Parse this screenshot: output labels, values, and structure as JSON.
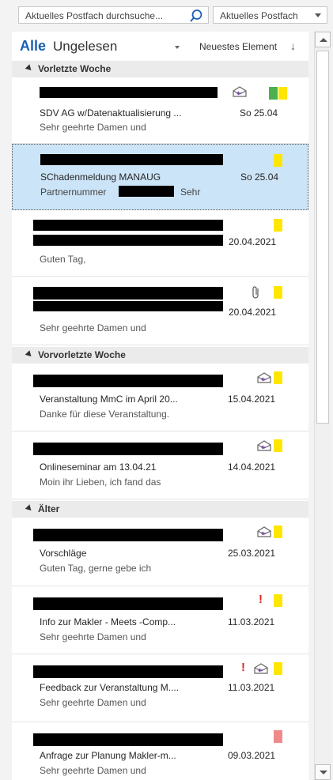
{
  "search": {
    "placeholder": "Aktuelles Postfach durchsuche...",
    "scope": "Aktuelles Postfach"
  },
  "filter": {
    "all": "Alle",
    "unread": "Ungelesen",
    "sort": "Neuestes Element",
    "sort_arrow": "↓"
  },
  "groups": {
    "g1": "Vorletzte Woche",
    "g2": "Vorvorletzte Woche",
    "g3": "Älter"
  },
  "mails": [
    {
      "subject": "SDV AG w/Datenaktualisierung ...",
      "date": "So 25.04",
      "preview": "Sehr geehrte Damen und"
    },
    {
      "subject": "SChadenmeldung MANAUG",
      "date": "So 25.04",
      "preview": "Partnernummer",
      "preview_tail": "Sehr"
    },
    {
      "subject": "",
      "date": "20.04.2021",
      "preview": "Guten Tag,"
    },
    {
      "subject": "",
      "date": "20.04.2021",
      "preview": "Sehr geehrte Damen und"
    },
    {
      "subject": "Veranstaltung MmC im April 20...",
      "date": "15.04.2021",
      "preview": "Danke für diese Veranstaltung."
    },
    {
      "subject": "Onlineseminar am 13.04.21",
      "date": "14.04.2021",
      "preview": "Moin ihr Lieben,  ich fand das"
    },
    {
      "subject": "Vorschläge",
      "date": "25.03.2021",
      "preview": "Guten Tag,  gerne gebe ich"
    },
    {
      "subject": "Info zur Makler - Meets -Comp...",
      "date": "11.03.2021",
      "preview": "Sehr geehrte Damen und",
      "important": "!"
    },
    {
      "subject": "Feedback zur Veranstaltung M....",
      "date": "11.03.2021",
      "preview": "Sehr geehrte Damen und",
      "important": "!"
    },
    {
      "subject": "Anfrage zur Planung Makler-m...",
      "date": "09.03.2021",
      "preview": "Sehr geehrte Damen und"
    }
  ],
  "colors": {
    "category_yellow": "#ffe600",
    "category_green": "#4caf50",
    "category_red": "#f08a8a",
    "selected_bg": "#cce4f7",
    "accent": "#1a5fb4"
  },
  "icons": [
    "search-icon",
    "dropdown-arrow-icon",
    "envelope-reply-icon",
    "category-flag-icon",
    "attachment-icon",
    "importance-icon",
    "collapse-triangle-icon"
  ]
}
